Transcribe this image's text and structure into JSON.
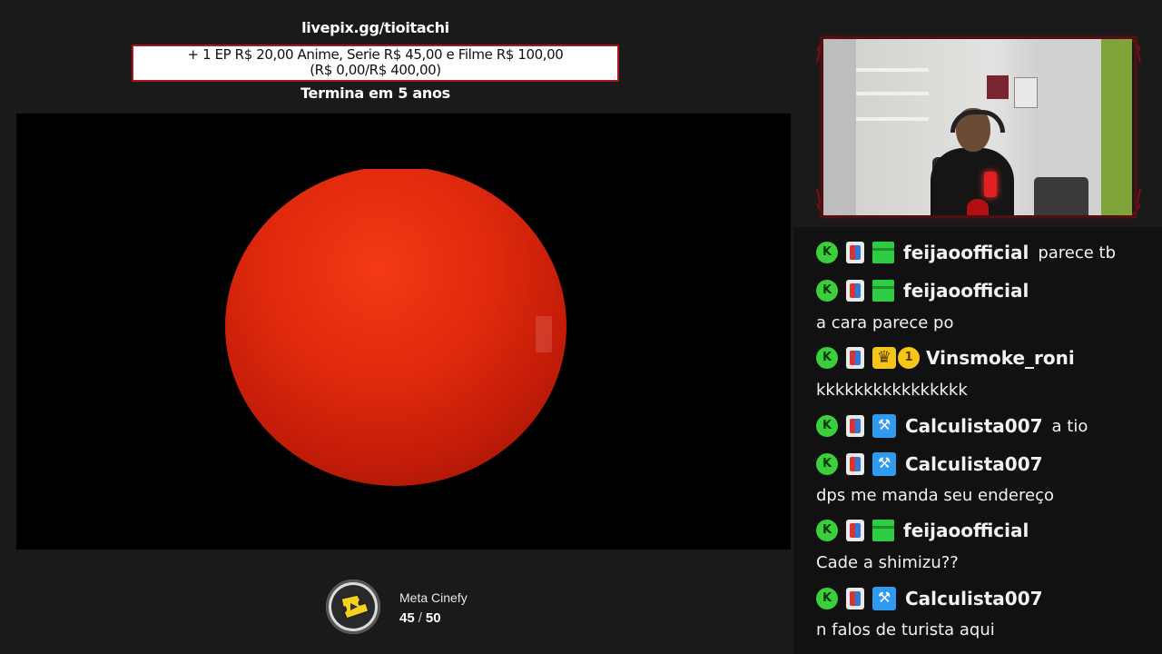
{
  "goal": {
    "url": "livepix.gg/tioitachi",
    "line1": "+ 1 EP R$ 20,00 Anime, Serie R$ 45,00 e Filme R$ 100,00",
    "line2": "(R$ 0,00/R$ 400,00)",
    "ends": "Termina em 5 anos"
  },
  "meta": {
    "icon": "cinefy-ticket-icon",
    "title": "Meta Cinefy",
    "current": "45",
    "separator": "/",
    "target": "50"
  },
  "colors": {
    "goal_border": "#b3121f",
    "sphere": "#e12a0d",
    "username": "#f2f2f2",
    "badge_green": "#3bcf3b",
    "badge_gold": "#f5c518",
    "badge_blue": "#2e9bf0"
  },
  "chat": {
    "messages": [
      {
        "user": "feijaoofficial",
        "badges": [
          "kick-icon",
          "pass-icon",
          "gift-sub-icon"
        ],
        "text": "parece tb"
      },
      {
        "user": "feijaoofficial",
        "badges": [
          "kick-icon",
          "pass-icon",
          "gift-sub-icon"
        ],
        "text": "a cara parece po"
      },
      {
        "user": "Vinsmoke_roni",
        "badges": [
          "kick-icon",
          "pass-icon",
          "crown-icon",
          "one-icon"
        ],
        "text": "kkkkkkkkkkkkkkkk"
      },
      {
        "user": "Calculista007",
        "badges": [
          "kick-icon",
          "pass-icon",
          "moderator-icon"
        ],
        "text": "a tio"
      },
      {
        "user": "Calculista007",
        "badges": [
          "kick-icon",
          "pass-icon",
          "moderator-icon"
        ],
        "text": "dps me manda seu endereço"
      },
      {
        "user": "feijaoofficial",
        "badges": [
          "kick-icon",
          "pass-icon",
          "gift-sub-icon"
        ],
        "text": "Cade a shimizu??"
      },
      {
        "user": "Calculista007",
        "badges": [
          "kick-icon",
          "pass-icon",
          "moderator-icon"
        ],
        "text": "n falos de turista aqui"
      }
    ]
  }
}
